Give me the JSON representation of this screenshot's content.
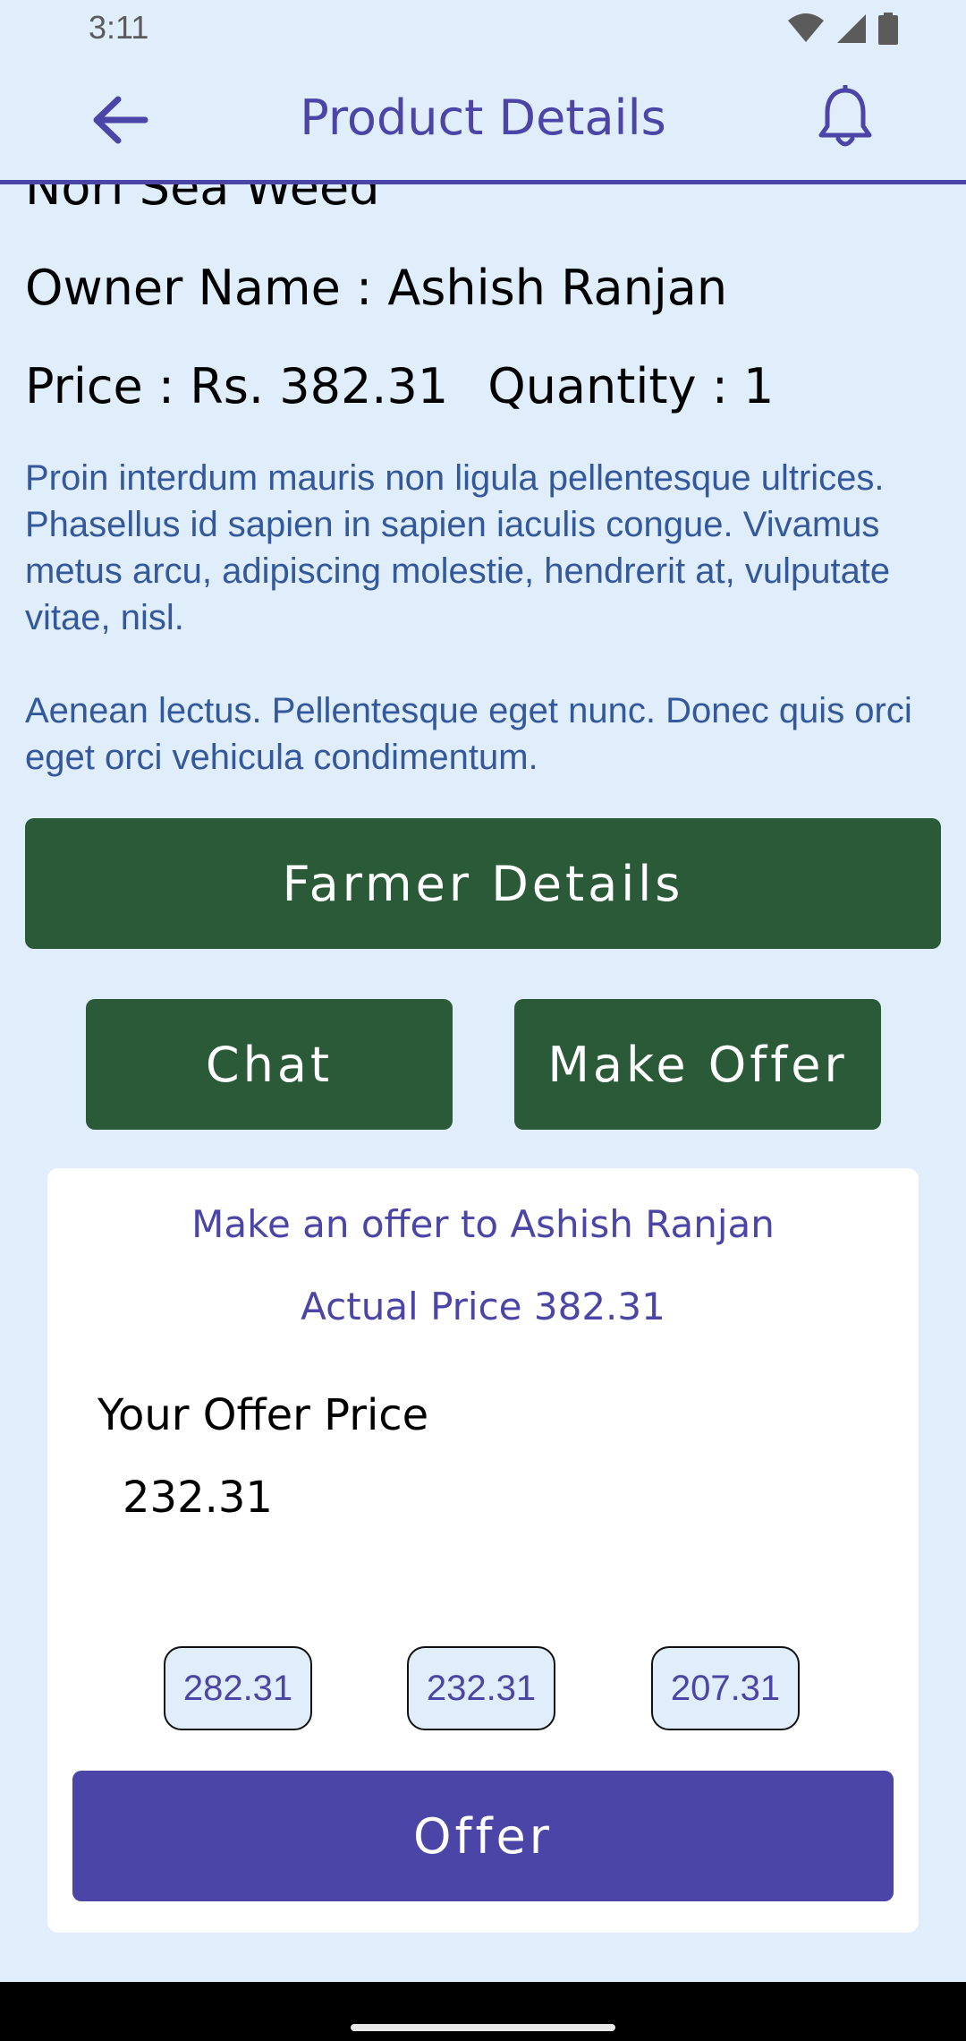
{
  "status_bar": {
    "time": "3:11",
    "icons": [
      "wifi-icon",
      "signal-icon",
      "battery-icon"
    ]
  },
  "app_bar": {
    "title": "Product Details",
    "back_icon": "arrow-left-icon",
    "notification_icon": "bell-icon"
  },
  "product": {
    "name": "Nori Sea Weed",
    "owner_line": "Owner Name : Ashish Ranjan",
    "price_line": "Price : Rs. 382.31",
    "quantity_line": "Quantity : 1",
    "description_p1": "Proin interdum mauris non ligula pellentesque ultrices. Phasellus id sapien in sapien iaculis congue. Vivamus metus arcu, adipiscing molestie, hendrerit at, vulputate vitae, nisl.",
    "description_p2": "Aenean lectus. Pellentesque eget nunc. Donec quis orci eget orci vehicula condimentum."
  },
  "actions": {
    "farmer_details_label": "Farmer Details",
    "chat_label": "Chat",
    "make_offer_label": "Make Offer"
  },
  "offer_dialog": {
    "heading": "Make an offer to Ashish Ranjan",
    "actual_price": "Actual Price 382.31",
    "field_label": "Your Offer Price",
    "field_value": "232.31",
    "suggestions": [
      "282.31",
      "232.31",
      "207.31"
    ],
    "submit_label": "Offer"
  },
  "colors": {
    "background": "#e0edfa",
    "accent": "#4a45a6",
    "button_green": "#2b5a38",
    "description_text": "#34589c"
  }
}
